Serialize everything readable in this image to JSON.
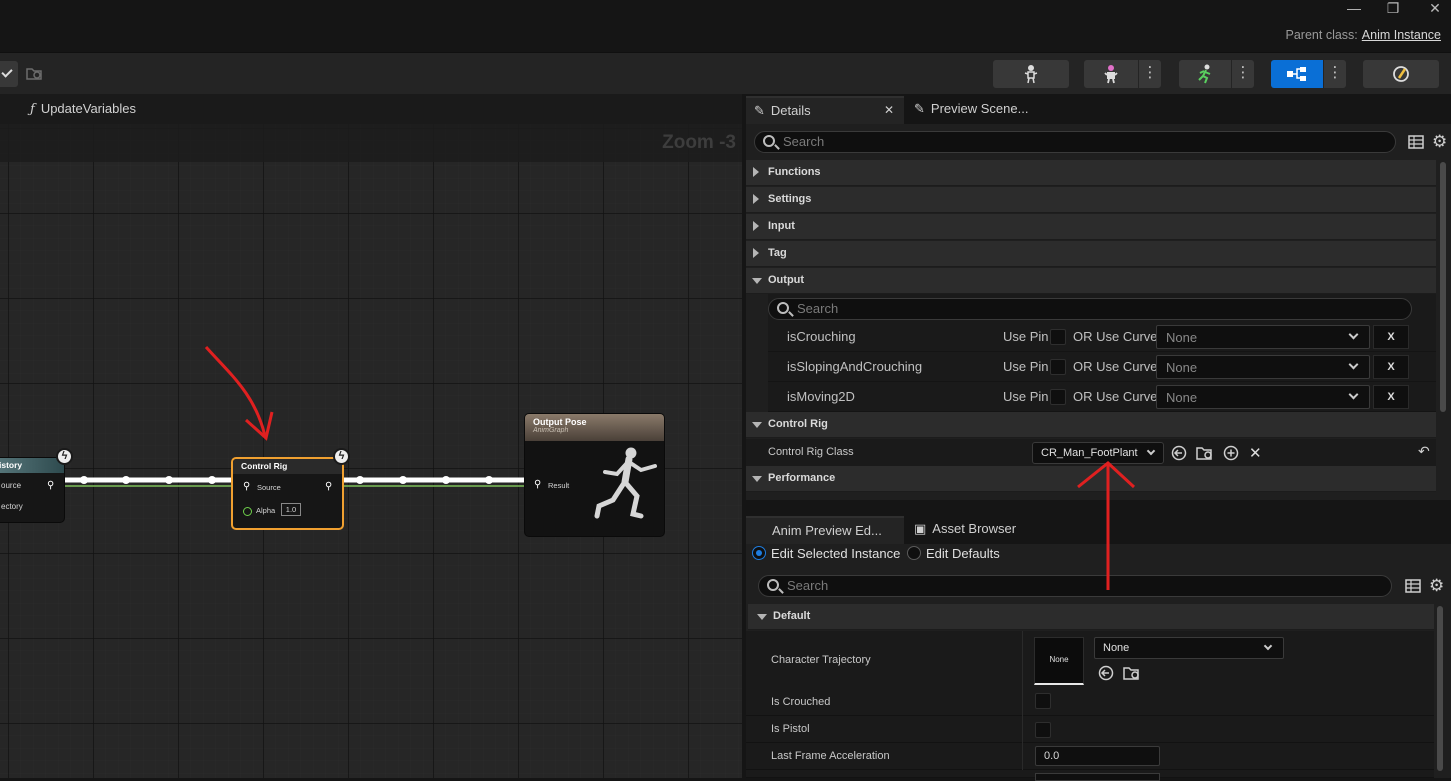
{
  "window": {
    "minimize": "—",
    "restore": "❐",
    "close": "✕",
    "parent_class_label": "Parent class:",
    "parent_class_value": "Anim Instance"
  },
  "graph": {
    "tab_label": "UpdateVariables",
    "zoom": "Zoom -3",
    "nodes": {
      "history": {
        "title": "istory",
        "pin1": "ource",
        "pin2": "ectory"
      },
      "control_rig": {
        "title": "Control Rig",
        "source": "Source",
        "alpha_label": "Alpha",
        "alpha_value": "1.0"
      },
      "output_pose": {
        "title": "Output Pose",
        "subtitle": "AnimGraph",
        "result": "Result"
      }
    }
  },
  "details": {
    "tab_details": "Details",
    "tab_preview_scene": "Preview Scene...",
    "search_placeholder": "Search",
    "categories": [
      "Functions",
      "Settings",
      "Input",
      "Tag"
    ],
    "output_label": "Output",
    "output_search_placeholder": "Search",
    "output_rows": [
      {
        "name": "isCrouching",
        "use_pin": "Use Pin",
        "or_curve": "OR Use Curve",
        "value": "None",
        "x": "X"
      },
      {
        "name": "isSlopingAndCrouching",
        "use_pin": "Use Pin",
        "or_curve": "OR Use Curve",
        "value": "None",
        "x": "X"
      },
      {
        "name": "isMoving2D",
        "use_pin": "Use Pin",
        "or_curve": "OR Use Curve",
        "value": "None",
        "x": "X"
      }
    ],
    "control_rig_label": "Control Rig",
    "control_rig_class_label": "Control Rig Class",
    "control_rig_class_value": "CR_Man_FootPlant",
    "performance_label": "Performance"
  },
  "preview": {
    "tab_anim_preview": "Anim Preview Ed...",
    "tab_asset_browser": "Asset Browser",
    "radio_edit_selected": "Edit Selected Instance",
    "radio_edit_defaults": "Edit Defaults",
    "search_placeholder": "Search",
    "default_label": "Default",
    "character_trajectory_label": "Character Trajectory",
    "thumbnail_label": "None",
    "trajectory_value": "None",
    "is_crouched_label": "Is Crouched",
    "is_pistol_label": "Is Pistol",
    "last_frame_accel_label": "Last Frame Acceleration",
    "last_frame_accel_value": "0.0"
  },
  "colors": {
    "accent_blue": "#0a6fd6",
    "annotation_red": "#e02020",
    "node_selected": "#f0a030"
  }
}
